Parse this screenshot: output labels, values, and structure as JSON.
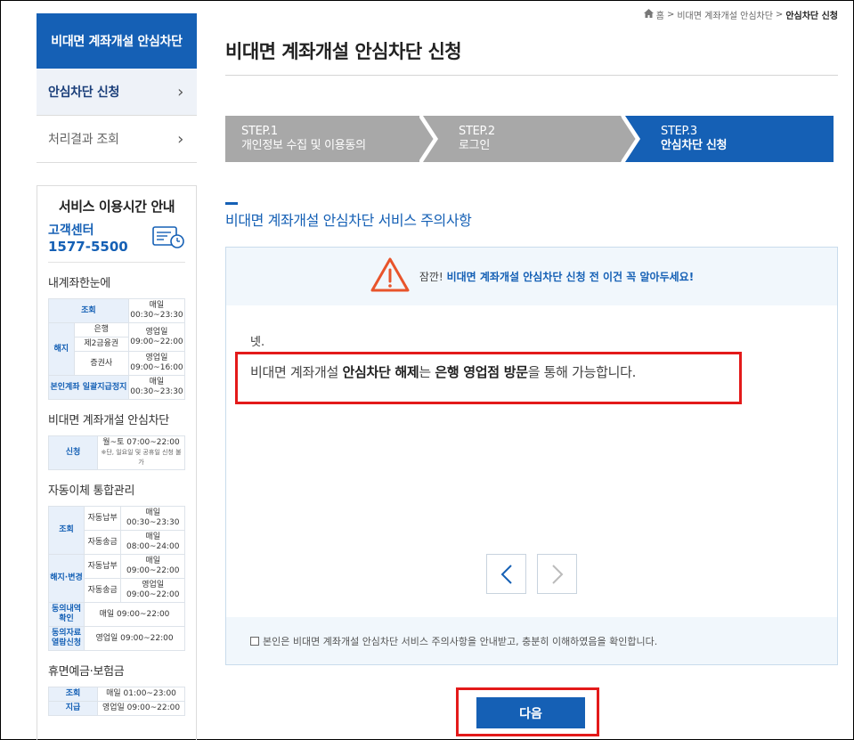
{
  "breadcrumb": {
    "home": "홈",
    "sep": ">",
    "level1": "비대면 계좌개설 안심차단",
    "current": "안심차단 신청"
  },
  "sidebar": {
    "header": "비대면 계좌개설 안심차단",
    "items": [
      {
        "label": "안심차단 신청",
        "active": true
      },
      {
        "label": "처리결과 조회",
        "active": false
      }
    ]
  },
  "service_hours": {
    "title": "서비스 이용시간 안내",
    "cs_label": "고객센터",
    "cs_number": "1577-5500",
    "sections": [
      {
        "title": "내계좌한눈에",
        "rows": [
          {
            "k": "조회",
            "s": "",
            "v1": "매일",
            "v2": "00:30~23:30"
          },
          {
            "k": "해지",
            "s": "은행",
            "v1": "영업일",
            "v2": "09:00~22:00"
          },
          {
            "k": "",
            "s": "제2금융권",
            "v1": "",
            "v2": ""
          },
          {
            "k": "",
            "s": "증권사",
            "v1": "영업일",
            "v2": "09:00~16:00"
          },
          {
            "k": "본인계좌 일괄지급정지",
            "s": "",
            "v1": "매일",
            "v2": "00:30~23:30"
          }
        ]
      },
      {
        "title": "비대면 계좌개설 안심차단",
        "rows": [
          {
            "k": "신청",
            "v1": "월~토 07:00~22:00",
            "note": "※단, 일요일 및 공휴일 신청 불가"
          }
        ]
      },
      {
        "title": "자동이체 통합관리",
        "rows": [
          {
            "k": "조회",
            "s": "자동납부",
            "v1": "매일",
            "v2": "00:30~23:30"
          },
          {
            "k": "",
            "s": "자동송금",
            "v1": "매일",
            "v2": "08:00~24:00"
          },
          {
            "k": "해지·변경",
            "s": "자동납부",
            "v1": "매일",
            "v2": "09:00~22:00"
          },
          {
            "k": "",
            "s": "자동송금",
            "v1": "영업일",
            "v2": "09:00~22:00"
          },
          {
            "k": "동의내역 확인",
            "v": "매일 09:00~22:00"
          },
          {
            "k": "동의자료 열람신청",
            "v": "영업일 09:00~22:00"
          }
        ]
      },
      {
        "title": "휴면예금·보험금",
        "rows": [
          {
            "k": "조회",
            "v": "매일 01:00~23:00"
          },
          {
            "k": "지급",
            "v": "영업일 09:00~22:00"
          }
        ]
      }
    ]
  },
  "page": {
    "title": "비대면 계좌개설 안심차단 신청",
    "steps": [
      {
        "num": "STEP.1",
        "label": "개인정보 수집 및 이용동의",
        "active": false
      },
      {
        "num": "STEP.2",
        "label": "로그인",
        "active": false
      },
      {
        "num": "STEP.3",
        "label": "안심차단 신청",
        "active": true
      }
    ],
    "section_title": "비대면 계좌개설 안심차단 서비스 주의사항",
    "warning_prefix": "잠깐!",
    "warning_text": "비대면 계좌개설 안심차단 신청 전 이건 꼭 알아두세요!",
    "content": {
      "lead": "넷.",
      "msg_a": "비대면 계좌개설 ",
      "msg_b": "안심차단 해제",
      "msg_c": "는 ",
      "msg_d": "은행 영업점 방문",
      "msg_e": "을 통해 가능합니다."
    },
    "pager": {
      "prev": "‹",
      "next": "›"
    },
    "agree_text": "본인은 비대면 계좌개설 안심차단 서비스 주의사항을 안내받고, 충분히 이해하였음을 확인합니다.",
    "next_button": "다음"
  },
  "colors": {
    "primary": "#1560b5",
    "step_inactive": "#a8a8a8",
    "highlight": "#e31a1a",
    "warning": "#e8542b"
  }
}
